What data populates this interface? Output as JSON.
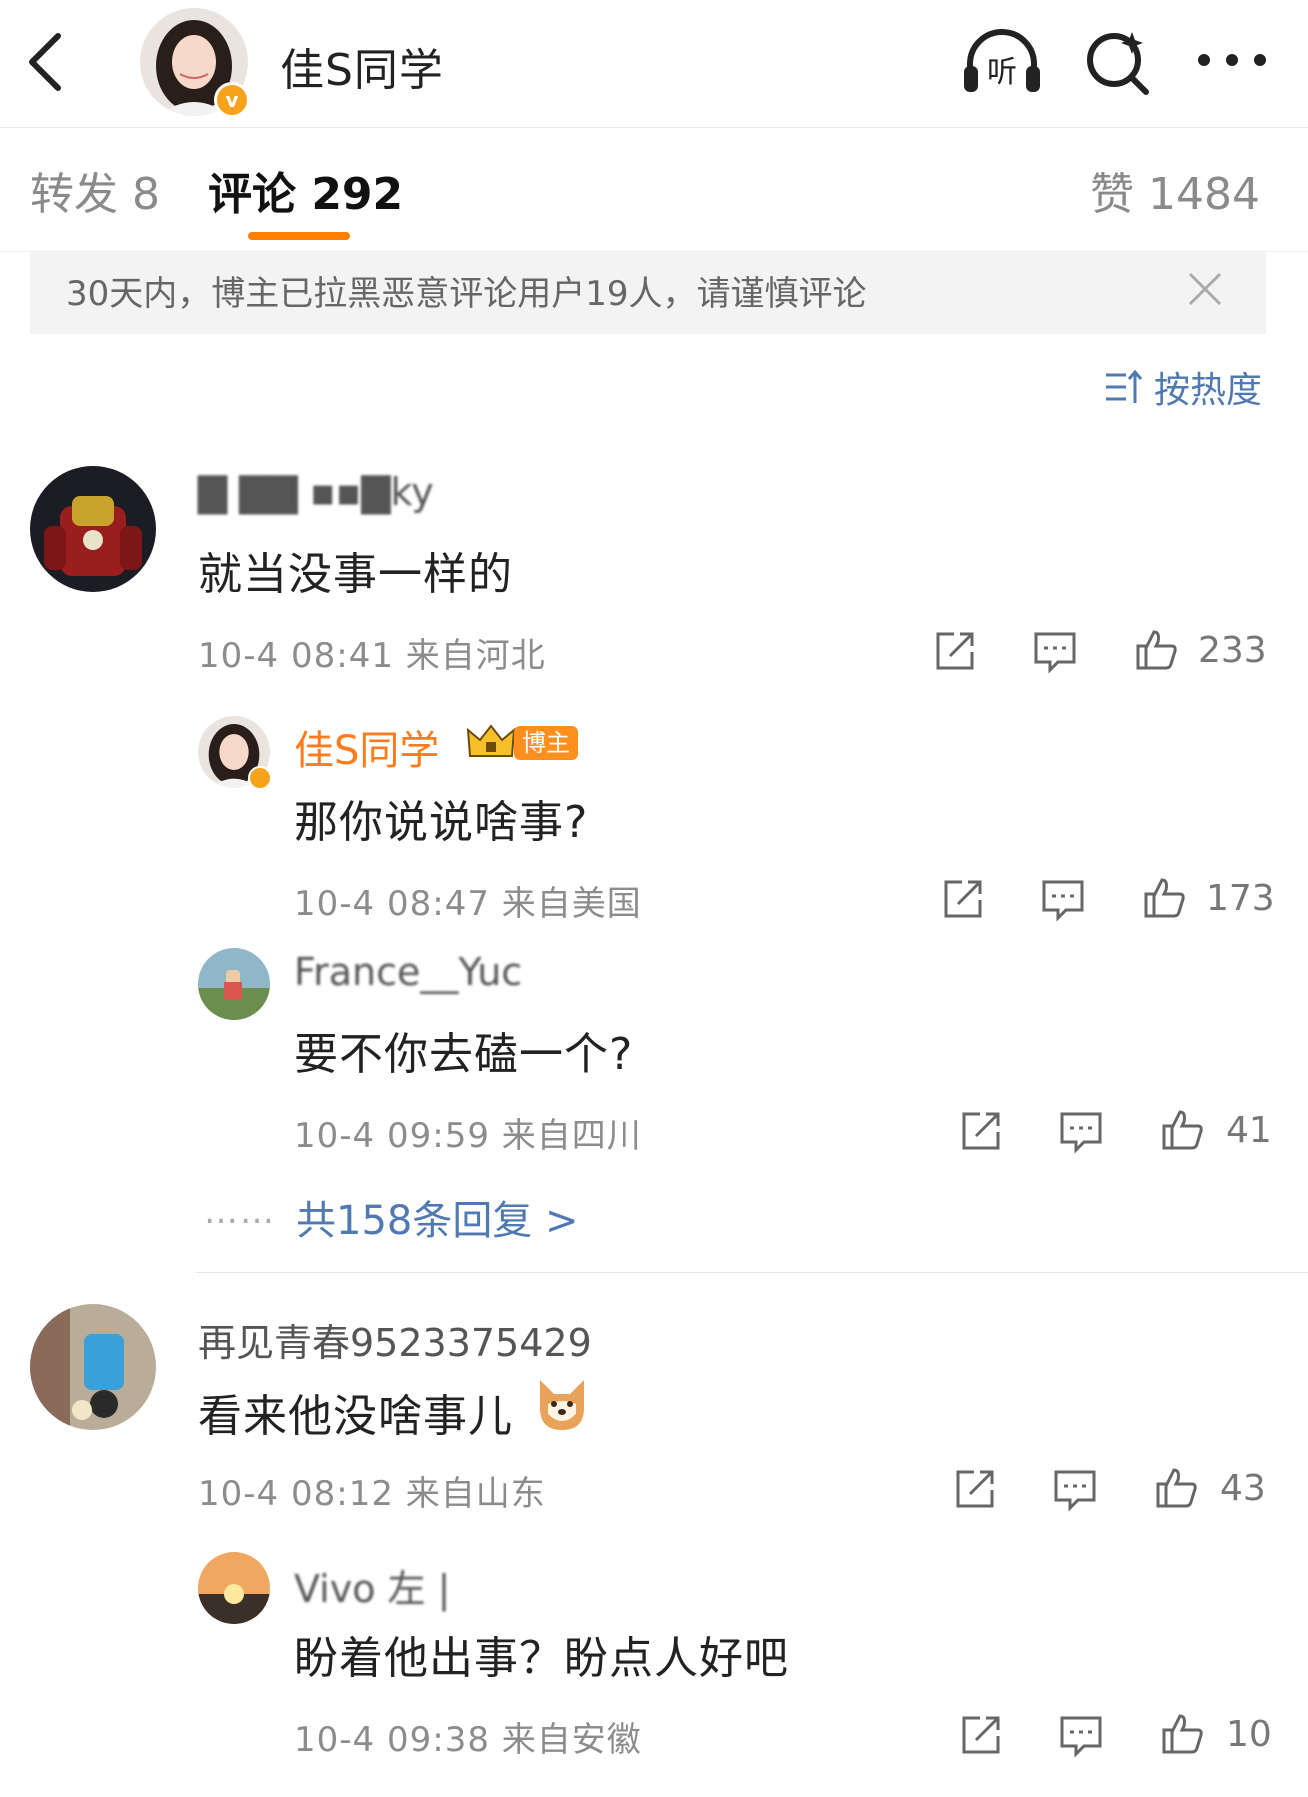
{
  "header": {
    "title": "佳S同学",
    "verified_mark": "v",
    "listen_label": "听"
  },
  "tabs": {
    "repost": "转发 8",
    "comment": "评论 292",
    "like": "赞 1484"
  },
  "notice": {
    "text": "30天内，博主已拉黑恶意评论用户19人，请谨慎评论"
  },
  "sort": {
    "label": "按热度"
  },
  "comments": [
    {
      "name": "▇  ▇▇  ▪▪▇ky",
      "text": "就当没事一样的",
      "meta": "10-4 08:41 来自河北",
      "likes": "233"
    },
    {
      "name": "再见青春9523375429",
      "text": "看来他没啥事儿",
      "meta": "10-4 08:12 来自山东",
      "likes": "43"
    }
  ],
  "replies": [
    {
      "name": "佳S同学",
      "badge": "博主",
      "text": "那你说说啥事?",
      "meta": "10-4 08:47 来自美国",
      "likes": "173"
    },
    {
      "name": "France__Yuc",
      "text": "要不你去磕一个?",
      "meta": "10-4 09:59 来自四川",
      "likes": "41"
    },
    {
      "name": "Vivo 左 |",
      "text": "盼着他出事？盼点人好吧",
      "meta": "10-4 09:38 来自安徽",
      "likes": "10"
    }
  ],
  "more_replies": {
    "dots": "……",
    "label": "共158条回复 >"
  },
  "colors": {
    "accent": "#ff7f00",
    "link": "#4f79b0",
    "owner": "#ff7b1c",
    "verified": "#f7a21b"
  }
}
